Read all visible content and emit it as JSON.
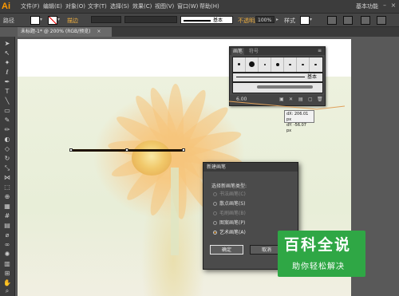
{
  "app": {
    "logo": "Ai"
  },
  "menu": {
    "items": [
      "文件(F)",
      "编辑(E)",
      "对象(O)",
      "文字(T)",
      "选择(S)",
      "效果(C)",
      "视图(V)",
      "窗口(W)",
      "帮助(H)"
    ],
    "workspace": "基本功能"
  },
  "controlbar": {
    "label_path": "路径",
    "stroke_label": "描边",
    "brush_name": "基本",
    "opacity_label": "不透明度",
    "opacity_value": "100%",
    "style_label": "样式"
  },
  "document": {
    "tab_title": "未标题-1* @ 200% (RGB/预览)",
    "close": "×"
  },
  "brushes_panel": {
    "tabs": [
      "画笔",
      "符号"
    ],
    "basic_label": "基本",
    "size_label": "6.00"
  },
  "tooltip": {
    "dx": "dX: 206.01 px",
    "dy": "dY: -56.07 px"
  },
  "dialog": {
    "title": "新建画笔",
    "prompt": "选择新画笔类型:",
    "options": [
      "书法画笔(C)",
      "散点画笔(S)",
      "毛刷画笔(B)",
      "图案画笔(P)",
      "艺术画笔(A)"
    ],
    "selected": "艺术画笔(A)",
    "ok": "确定",
    "cancel": "取消"
  },
  "watermark": {
    "title": "百科全说",
    "subtitle": "助你轻松解决"
  },
  "colors": {
    "accent": "#ff9a00",
    "panel": "#454545",
    "watermark": "#2fa745"
  }
}
